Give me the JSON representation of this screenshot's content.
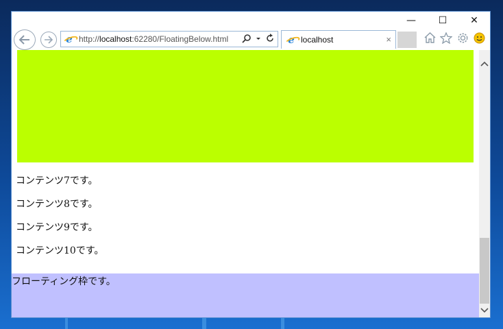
{
  "window": {
    "controls": {
      "minimize": "—",
      "maximize": "☐",
      "close": "✕"
    }
  },
  "address": {
    "url_prefix": "http://",
    "url_host": "localhost",
    "url_rest": ":62280/FloatingBelow.html"
  },
  "tab": {
    "title": "localhost",
    "close": "×"
  },
  "content": {
    "lines": [
      "コンテンツ7です。",
      "コンテンツ8です。",
      "コンテンツ9です。",
      "コンテンツ10です。"
    ],
    "floating_text": "フローティング枠です。"
  },
  "colors": {
    "green_block": "#bbff00",
    "floating_bg": "#c0c0ff"
  },
  "icons": {
    "back": "back-arrow-icon",
    "forward": "forward-arrow-icon",
    "search": "search-icon",
    "refresh": "refresh-icon",
    "home": "home-icon",
    "favorites": "star-icon",
    "settings": "gear-icon",
    "feedback": "smiley-icon"
  }
}
